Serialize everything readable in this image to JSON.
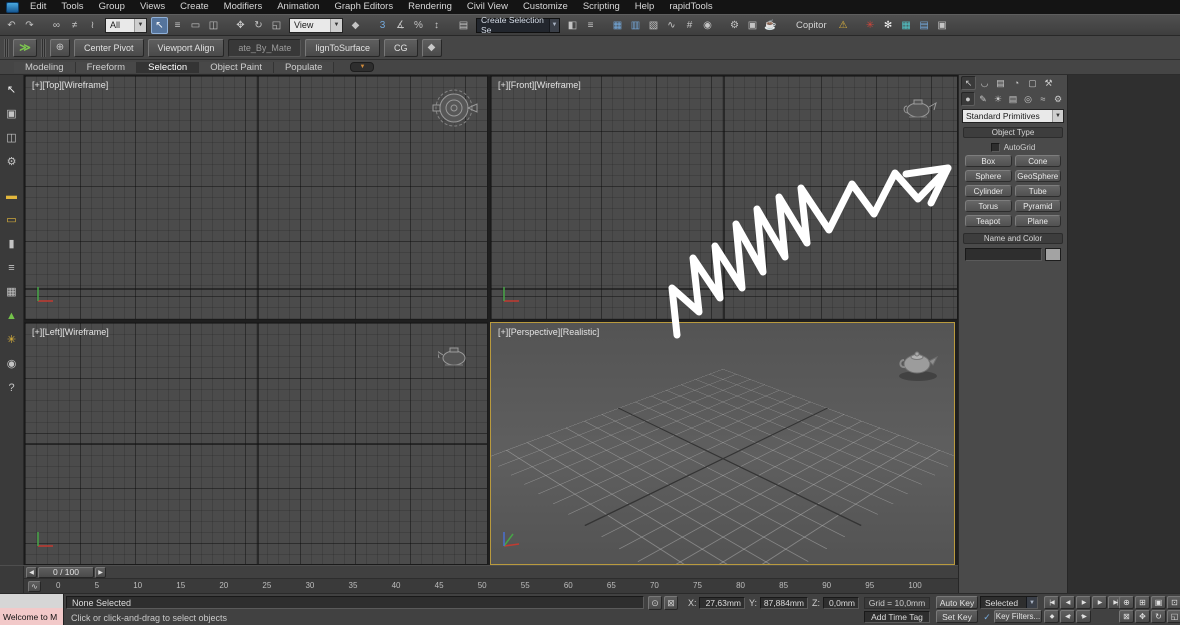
{
  "menu": {
    "items": [
      "Edit",
      "Tools",
      "Group",
      "Views",
      "Create",
      "Modifiers",
      "Animation",
      "Graph Editors",
      "Rendering",
      "Civil View",
      "Customize",
      "Scripting",
      "Help",
      "rapidTools"
    ]
  },
  "toolbar_main": {
    "icons_a": [
      {
        "name": "undo-icon",
        "glyph": "↶"
      },
      {
        "name": "redo-icon",
        "glyph": "↷"
      },
      {
        "name": "separator",
        "type": "sep",
        "inter": "false"
      },
      {
        "name": "select-and-link-icon",
        "glyph": "∞"
      },
      {
        "name": "unlink-selection-icon",
        "glyph": "≠"
      },
      {
        "name": "bind-to-spacewarp-icon",
        "glyph": "≀"
      }
    ],
    "selection_filter_value": "All",
    "icons_b": [
      {
        "name": "select-object-icon",
        "glyph": "↖",
        "active": true,
        "tone": "white"
      },
      {
        "name": "select-by-name-icon",
        "glyph": "≡"
      },
      {
        "name": "selection-region-icon",
        "glyph": "▭"
      },
      {
        "name": "window-crossing-icon",
        "glyph": "◫"
      },
      {
        "name": "separator",
        "type": "sep",
        "inter": "false"
      },
      {
        "name": "select-and-move-icon",
        "glyph": "✥"
      },
      {
        "name": "select-and-rotate-icon",
        "glyph": "↻"
      },
      {
        "name": "select-and-scale-icon",
        "glyph": "◱"
      }
    ],
    "coord_system_value": "View",
    "icons_c": [
      {
        "name": "select-and-manipulate-icon",
        "glyph": "◆"
      },
      {
        "name": "separator",
        "type": "sep",
        "inter": "false"
      },
      {
        "name": "snaps-toggle-icon",
        "glyph": "3",
        "tone": "blue"
      },
      {
        "name": "angle-snap-icon",
        "glyph": "∡"
      },
      {
        "name": "percent-snap-icon",
        "glyph": "%"
      },
      {
        "name": "spinner-snap-icon",
        "glyph": "↕"
      },
      {
        "name": "separator",
        "type": "sep",
        "inter": "false"
      },
      {
        "name": "edit-named-selections-icon",
        "glyph": "▤"
      }
    ],
    "named_selection_value": "Create Selection Se",
    "icons_d": [
      {
        "name": "mirror-icon",
        "glyph": "◧"
      },
      {
        "name": "align-icon",
        "glyph": "≡"
      },
      {
        "name": "separator",
        "type": "sep",
        "inter": "false"
      },
      {
        "name": "layer-manager-icon",
        "glyph": "▦",
        "tone": "blue"
      },
      {
        "name": "scene-explorer-icon",
        "glyph": "▥",
        "tone": "blue"
      },
      {
        "name": "graphite-ribbon-icon",
        "glyph": "▧"
      },
      {
        "name": "curve-editor-icon",
        "glyph": "∿"
      },
      {
        "name": "schematic-view-icon",
        "glyph": "#"
      },
      {
        "name": "material-editor-icon",
        "glyph": "◉"
      },
      {
        "name": "separator",
        "type": "sep",
        "inter": "false"
      },
      {
        "name": "render-setup-icon",
        "glyph": "⚙"
      },
      {
        "name": "rendered-frame-icon",
        "glyph": "▣"
      },
      {
        "name": "render-production-icon",
        "glyph": "☕",
        "tone": "yellow"
      },
      {
        "name": "separator",
        "type": "sep",
        "inter": "false"
      }
    ],
    "copitor_label": "Copitor",
    "icons_e": [
      {
        "name": "warning-icon",
        "glyph": "⚠",
        "tone": "yellow"
      },
      {
        "name": "separator",
        "type": "sep",
        "inter": "false"
      },
      {
        "name": "red-plugin-icon",
        "glyph": "✳",
        "tone": "red"
      },
      {
        "name": "snowflake-plugin-icon",
        "glyph": "✻",
        "tone": "white"
      },
      {
        "name": "grid-plugin-icon",
        "glyph": "▦",
        "tone": "teal"
      },
      {
        "name": "grid-plugin-2-icon",
        "glyph": "▤",
        "tone": "blue"
      },
      {
        "name": "tex-plugin-icon",
        "glyph": "▣"
      },
      {
        "name": "separator",
        "type": "sep",
        "inter": "false"
      }
    ]
  },
  "toolbar_custom": {
    "ribbon_toggle_glyph": "≫",
    "pivot_icon_glyph": "⊕",
    "pin_icon_glyph": "◆",
    "buttons": [
      {
        "name": "center-pivot-button",
        "label": "Center Pivot"
      },
      {
        "name": "viewport-align-button",
        "label": "Viewport Align"
      },
      {
        "name": "rotate-by-material-button",
        "label": "ate_By_Mate",
        "variant": "dark"
      },
      {
        "name": "align-to-surface-button",
        "label": "lignToSurface"
      },
      {
        "name": "cg-button",
        "label": "CG"
      }
    ]
  },
  "ribbon": {
    "tabs": [
      {
        "label": "Modeling"
      },
      {
        "label": "Freeform"
      },
      {
        "label": "Selection",
        "active": true
      },
      {
        "label": "Object Paint"
      },
      {
        "label": "Populate"
      }
    ],
    "minimize_glyph": "▼"
  },
  "left_toolbar": {
    "icons": [
      {
        "name": "select-cursor-icon",
        "glyph": "↖",
        "tone": "white"
      },
      {
        "name": "window-icon",
        "glyph": "▣"
      },
      {
        "name": "panels-icon",
        "glyph": "◫"
      },
      {
        "name": "gear-icon",
        "glyph": "⚙"
      },
      {
        "name": "yellow-bar-icon",
        "glyph": "▬",
        "tone": "yellow"
      },
      {
        "name": "yellow-tray-icon",
        "glyph": "▭",
        "tone": "yellow"
      },
      {
        "name": "cylinder-icon",
        "glyph": "▮"
      },
      {
        "name": "list-icon",
        "glyph": "≡"
      },
      {
        "name": "grid-icon",
        "glyph": "▦"
      },
      {
        "name": "green-triangle-icon",
        "glyph": "▲",
        "tone": "green"
      },
      {
        "name": "yellow-burst-icon",
        "glyph": "✳",
        "tone": "yellow"
      },
      {
        "name": "bulb-icon",
        "glyph": "◉"
      },
      {
        "name": "help-icon",
        "glyph": "?"
      }
    ]
  },
  "viewports": {
    "top_label": "[+][Top][Wireframe]",
    "front_label": "[+][Front][Wireframe]",
    "left_label": "[+][Left][Wireframe]",
    "persp_label": "[+][Perspective][Realistic]"
  },
  "command_panel": {
    "tab_icons": [
      {
        "name": "create-tab-icon",
        "glyph": "↖",
        "active": true,
        "tone": "white"
      },
      {
        "name": "modify-tab-icon",
        "glyph": "◡",
        "tone": "blue"
      },
      {
        "name": "hierarchy-tab-icon",
        "glyph": "▤"
      },
      {
        "name": "motion-tab-icon",
        "glyph": "◔"
      },
      {
        "name": "display-tab-icon",
        "glyph": "▢"
      },
      {
        "name": "utilities-tab-icon",
        "glyph": "⚒"
      }
    ],
    "category_icons": [
      {
        "name": "geometry-category-icon",
        "glyph": "●",
        "active": true,
        "tone": "blue"
      },
      {
        "name": "shapes-category-icon",
        "glyph": "✎"
      },
      {
        "name": "lights-category-icon",
        "glyph": "☀"
      },
      {
        "name": "cameras-category-icon",
        "glyph": "▤"
      },
      {
        "name": "helpers-category-icon",
        "glyph": "◎"
      },
      {
        "name": "spacewarps-category-icon",
        "glyph": "≈"
      },
      {
        "name": "systems-category-icon",
        "glyph": "⚙"
      }
    ],
    "dropdown_value": "Standard Primitives",
    "object_type_title": "Object Type",
    "autogrid_label": "AutoGrid",
    "primitive_buttons": [
      {
        "label": "Box"
      },
      {
        "label": "Cone"
      },
      {
        "label": "Sphere"
      },
      {
        "label": "GeoSphere"
      },
      {
        "label": "Cylinder"
      },
      {
        "label": "Tube"
      },
      {
        "label": "Torus"
      },
      {
        "label": "Pyramid"
      },
      {
        "label": "Teapot"
      },
      {
        "label": "Plane"
      }
    ],
    "name_color_title": "Name and Color"
  },
  "timeline": {
    "slider_label": "0 / 100",
    "prev_glyph": "◀",
    "next_glyph": "▶",
    "curve_editor_glyph": "∿",
    "ticks": [
      "0",
      "5",
      "10",
      "15",
      "20",
      "25",
      "30",
      "35",
      "40",
      "45",
      "50",
      "55",
      "60",
      "65",
      "70",
      "75",
      "80",
      "85",
      "90",
      "95",
      "100"
    ]
  },
  "status_bar": {
    "mini_listener_text": "Welcome to M",
    "status_text": "None Selected",
    "prompt_text": "Click or click-and-drag to select objects",
    "isolate_glyph": "⊙",
    "lock_glyph": "⊠",
    "x_label": "X:",
    "x_value": "27,63mm",
    "y_label": "Y:",
    "y_value": "87,884mm",
    "z_label": "Z:",
    "z_value": "0,0mm",
    "grid_text": "Grid = 10,0mm",
    "add_time_tag": "Add Time Tag",
    "auto_key_label": "Auto Key",
    "set_key_label": "Set Key",
    "selected_set_value": "Selected",
    "key_filters_label": "Key Filters...",
    "key_filter_check_glyph": "✓",
    "transport_icons": [
      {
        "name": "go-to-start-icon",
        "glyph": "|◀"
      },
      {
        "name": "prev-frame-icon",
        "glyph": "◀"
      },
      {
        "name": "play-icon",
        "glyph": "▶"
      },
      {
        "name": "next-frame-icon",
        "glyph": "▶"
      },
      {
        "name": "go-to-end-icon",
        "glyph": "▶|"
      }
    ],
    "transport_icons_2": [
      {
        "name": "key-mode-icon",
        "glyph": "◆"
      },
      {
        "name": "prev-key-icon",
        "glyph": "◀•"
      },
      {
        "name": "next-key-icon",
        "glyph": "•▶"
      }
    ],
    "nav_icons": [
      {
        "name": "zoom-icon",
        "glyph": "⊕"
      },
      {
        "name": "zoom-all-icon",
        "glyph": "⊞"
      },
      {
        "name": "zoom-extents-icon",
        "glyph": "▣"
      },
      {
        "name": "zoom-extents-all-icon",
        "glyph": "⊡"
      },
      {
        "name": "zoom-region-icon",
        "glyph": "⊠"
      },
      {
        "name": "pan-icon",
        "glyph": "✥"
      },
      {
        "name": "orbit-icon",
        "glyph": "↻"
      },
      {
        "name": "maximize-viewport-icon",
        "glyph": "◱"
      }
    ]
  },
  "colors": {
    "active_viewport_border": "#b99a3e",
    "accent_blue": "#55749c",
    "warning_yellow": "#e2b73c",
    "listener_pink": "#f2c9c9"
  }
}
